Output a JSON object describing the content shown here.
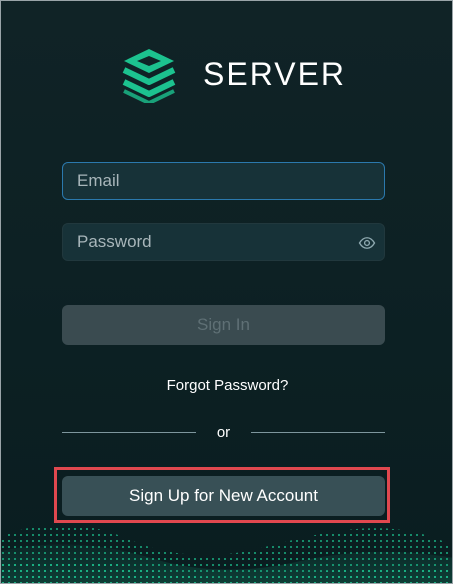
{
  "brand": {
    "name": "SERVER",
    "accent": "#1cc28f"
  },
  "form": {
    "email_placeholder": "Email",
    "password_placeholder": "Password",
    "signin_label": "Sign In",
    "forgot_label": "Forgot Password?",
    "divider_label": "or",
    "signup_label": "Sign Up for New Account"
  },
  "colors": {
    "background": "#0d2124",
    "highlight": "#e0484f",
    "email_border": "#2b79ad"
  }
}
